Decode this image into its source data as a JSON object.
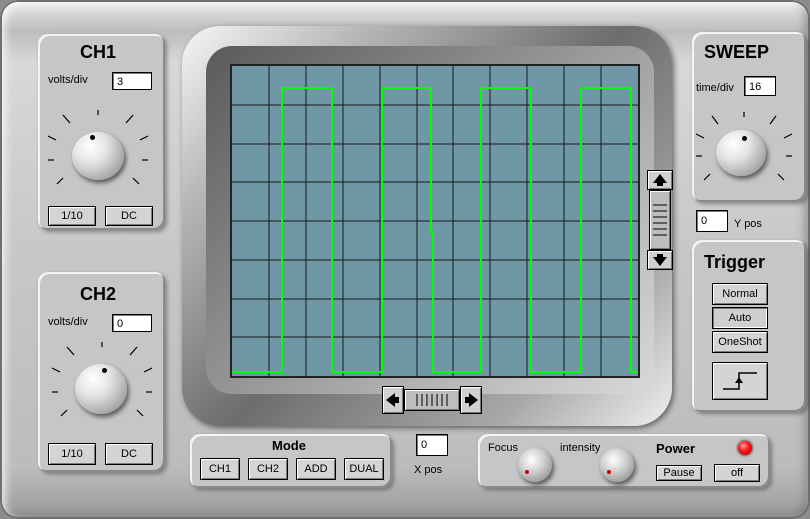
{
  "ch1": {
    "title": "CH1",
    "volts_label": "volts/div",
    "volts_value": "3",
    "btn_div": "1/10",
    "btn_coupling": "DC"
  },
  "ch2": {
    "title": "CH2",
    "volts_label": "volts/div",
    "volts_value": "0",
    "btn_div": "1/10",
    "btn_coupling": "DC"
  },
  "sweep": {
    "title": "SWEEP",
    "time_label": "time/div",
    "time_value": "16",
    "ypos_label": "Y pos",
    "ypos_value": "0"
  },
  "trigger": {
    "title": "Trigger",
    "buttons": [
      "Normal",
      "Auto",
      "OneShot"
    ],
    "selected": "Auto"
  },
  "mode": {
    "title": "Mode",
    "buttons": [
      "CH1",
      "CH2",
      "ADD",
      "DUAL"
    ]
  },
  "xpos": {
    "label": "X pos",
    "value": "0"
  },
  "power": {
    "focus_label": "Focus",
    "intensity_label": "intensity",
    "title": "Power",
    "pause_label": "Pause",
    "off_label": "off"
  },
  "screen": {
    "background": "#6f97a6",
    "grid_color": "#1a1a1a",
    "trace_color": "#00ff00",
    "grid_divisions": {
      "cols": 11,
      "rows": 8
    }
  }
}
